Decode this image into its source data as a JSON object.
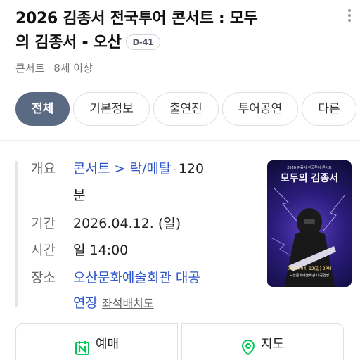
{
  "header": {
    "title_line1": "2026 김종서 전국투어 콘서트 : 모두",
    "title_line2": "의 김종서 - 오산",
    "dday_badge": "D-41"
  },
  "subinfo": {
    "category": "콘서트",
    "separator": "·",
    "age": "8세 이상"
  },
  "tabs": [
    {
      "label": "전체",
      "active": true
    },
    {
      "label": "기본정보",
      "active": false
    },
    {
      "label": "출연진",
      "active": false
    },
    {
      "label": "투어공연",
      "active": false
    },
    {
      "label": "다른",
      "active": false
    }
  ],
  "info": {
    "overview": {
      "label": "개요",
      "genre_parent": "콘서트",
      "arrow": ">",
      "genre_child": "락/메탈",
      "separator": "·",
      "duration_num": "120",
      "duration_unit": "분"
    },
    "period": {
      "label": "기간",
      "value": "2026.04.12. (일)"
    },
    "time": {
      "label": "시간",
      "value": "일 14:00"
    },
    "venue": {
      "label": "장소",
      "value_line1": "오산문화예술회관 대공",
      "value_line2": "연장",
      "seat_map": "좌석배치도"
    }
  },
  "poster": {
    "small_top": "2026 김종서 전국투어 콘서트",
    "title": "모두의 김종서",
    "date": "2026. 04. 12(일) 2PM",
    "venue": "오산문화예술회관 대공연장"
  },
  "actions": {
    "book": "예매",
    "map": "지도"
  },
  "colors": {
    "active_tab": "#5b6a83",
    "link": "#2e56c9",
    "naver_green": "#03c75a"
  }
}
